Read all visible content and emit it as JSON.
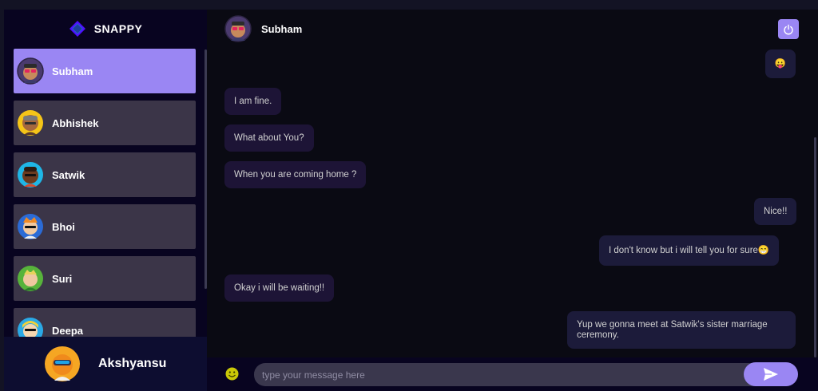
{
  "brand": {
    "name": "SNAPPY"
  },
  "contacts": [
    {
      "name": "Subham",
      "selected": true
    },
    {
      "name": "Abhishek",
      "selected": false
    },
    {
      "name": "Satwik",
      "selected": false
    },
    {
      "name": "Bhoi",
      "selected": false
    },
    {
      "name": "Suri",
      "selected": false
    },
    {
      "name": "Deepa",
      "selected": false
    }
  ],
  "current_user": {
    "name": "Akshyansu"
  },
  "chat": {
    "contact_name": "Subham",
    "messages": [
      {
        "text": "😛",
        "direction": "sent"
      },
      {
        "text": "I am fine.",
        "direction": "received"
      },
      {
        "text": "What about You?",
        "direction": "received"
      },
      {
        "text": "When you are coming home ?",
        "direction": "received"
      },
      {
        "text": "Nice!!",
        "direction": "sent"
      },
      {
        "text": "I don't know but i will tell you for sure😁",
        "direction": "sent"
      },
      {
        "text": "Okay i will be waiting!!",
        "direction": "received"
      },
      {
        "text": "Yup we gonna meet at Satwik's sister marriage ceremony.",
        "direction": "sent"
      }
    ]
  },
  "input": {
    "placeholder": "type your message here",
    "value": ""
  },
  "icons": {
    "logout": "power-icon",
    "emoji": "emoji-icon",
    "send": "send-icon",
    "brand": "brand-logo-icon"
  },
  "colors": {
    "accent": "#9a86f3",
    "background": "#131324",
    "sidebar": "#080420"
  }
}
